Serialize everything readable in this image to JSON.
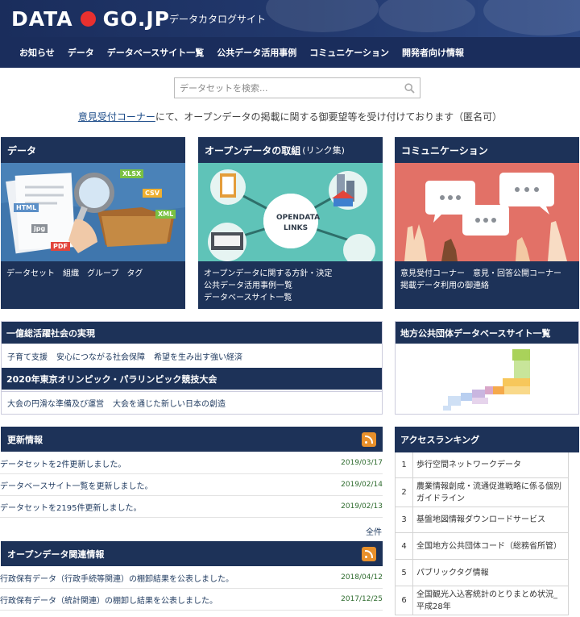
{
  "header": {
    "logo_left": "DATA",
    "logo_right": "GO.JP",
    "tagline": "データカタログサイト"
  },
  "nav": [
    "お知らせ",
    "データ",
    "データベースサイト一覧",
    "公共データ活用事例",
    "コミュニケーション",
    "開発者向け情報"
  ],
  "search": {
    "placeholder": "データセットを検索..."
  },
  "notice": {
    "link": "意見受付コーナー",
    "text": "にて、オープンデータの掲載に関する御要望等を受け付けております（匿名可）"
  },
  "cards": {
    "data": {
      "title": "データ",
      "links": [
        "データセット",
        "組織",
        "グループ",
        "タグ"
      ],
      "badges": {
        "xlsx": "XLSX",
        "csv": "CSV",
        "xml": "XML",
        "html": "HTML",
        "jpg": "jpg",
        "pdf": "PDF"
      }
    },
    "opendata": {
      "title": "オープンデータの取組",
      "title_sub": "(リンク集)",
      "center_line1": "OPENDATA",
      "center_line2": "LINKS",
      "links": [
        "オープンデータに関する方針・決定",
        "公共データ活用事例一覧",
        "データベースサイト一覧"
      ]
    },
    "communication": {
      "title": "コミュニケーション",
      "links_row1": [
        "意見受付コーナー",
        "意見・回答公開コーナー"
      ],
      "links_row2": [
        "掲載データ利用の御連絡"
      ]
    }
  },
  "society": {
    "title": "一億総活躍社会の実現",
    "links": [
      "子育て支援",
      "安心につながる社会保障",
      "希望を生み出す強い経済"
    ]
  },
  "olympics": {
    "title": "2020年東京オリンピック・パラリンピック競技大会",
    "links": [
      "大会の円滑な準備及び運営",
      "大会を通じた新しい日本の創造"
    ]
  },
  "local_db": {
    "title": "地方公共団体データベースサイト一覧"
  },
  "updates": {
    "title": "更新情報",
    "items": [
      {
        "text": "データセットを2件更新しました。",
        "date": "2019/03/17"
      },
      {
        "text": "データベースサイト一覧を更新しました。",
        "date": "2019/02/14"
      },
      {
        "text": "データセットを2195件更新しました。",
        "date": "2019/02/13"
      }
    ],
    "all_link": "全件"
  },
  "related": {
    "title": "オープンデータ関連情報",
    "items": [
      {
        "text": "行政保有データ（行政手続等関連）の棚卸結果を公表しました。",
        "date": "2018/04/12"
      },
      {
        "text": "行政保有データ（統計関連）の棚卸し結果を公表しました。",
        "date": "2017/12/25"
      }
    ]
  },
  "ranking": {
    "title": "アクセスランキング",
    "items": [
      {
        "num": "1",
        "label": "歩行空間ネットワークデータ"
      },
      {
        "num": "2",
        "label": "農業情報創成・流通促進戦略に係る個別ガイドライン"
      },
      {
        "num": "3",
        "label": "基盤地図情報ダウンロードサービス"
      },
      {
        "num": "4",
        "label": "全国地方公共団体コード（総務省所管）"
      },
      {
        "num": "5",
        "label": "パブリックタグ情報"
      },
      {
        "num": "6",
        "label": "全国観光入込客統計のとりまとめ状況_平成28年"
      }
    ]
  },
  "colors": {
    "navy": "#1d3258",
    "header": "#1a2d5c",
    "accent_red": "#e8302f",
    "rss": "#e8902b"
  },
  "icons": {
    "search": "search-icon",
    "rss": "rss-icon"
  }
}
